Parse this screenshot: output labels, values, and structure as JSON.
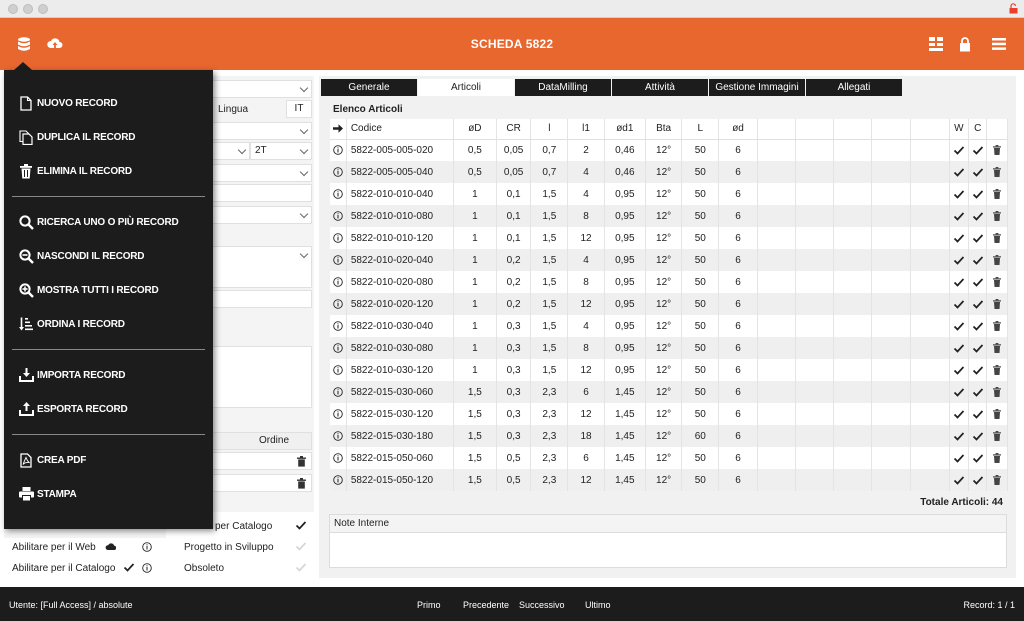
{
  "header": {
    "title": "SCHEDA 5822",
    "accent_color": "#e8672f"
  },
  "left_form": {
    "lingua_label": "Lingua",
    "lingua_value": "IT",
    "select_value": "2T",
    "ordine_header": "Ordine",
    "flags": [
      {
        "label": "Abilitare per il Web"
      },
      {
        "label": "Abilitare per il Catalogo"
      }
    ],
    "status_options": [
      {
        "label": "per Catalogo"
      },
      {
        "label": "Progetto in Sviluppo"
      },
      {
        "label": "Obsoleto"
      }
    ]
  },
  "tabs": [
    {
      "label": "Generale"
    },
    {
      "label": "Articoli"
    },
    {
      "label": "DataMilling"
    },
    {
      "label": "Attività"
    },
    {
      "label": "Gestione Immagini"
    },
    {
      "label": "Allegati"
    }
  ],
  "active_tab": 1,
  "articles": {
    "title": "Elenco Articoli",
    "columns": [
      "Codice",
      "øD",
      "CR",
      "l",
      "l1",
      "ød1",
      "Bta",
      "L",
      "ød"
    ],
    "flag_columns": [
      "W",
      "C"
    ],
    "rows": [
      [
        "5822-005-005-020",
        "0,5",
        "0,05",
        "0,7",
        "2",
        "0,46",
        "12°",
        "50",
        "6"
      ],
      [
        "5822-005-005-040",
        "0,5",
        "0,05",
        "0,7",
        "4",
        "0,46",
        "12°",
        "50",
        "6"
      ],
      [
        "5822-010-010-040",
        "1",
        "0,1",
        "1,5",
        "4",
        "0,95",
        "12°",
        "50",
        "6"
      ],
      [
        "5822-010-010-080",
        "1",
        "0,1",
        "1,5",
        "8",
        "0,95",
        "12°",
        "50",
        "6"
      ],
      [
        "5822-010-010-120",
        "1",
        "0,1",
        "1,5",
        "12",
        "0,95",
        "12°",
        "50",
        "6"
      ],
      [
        "5822-010-020-040",
        "1",
        "0,2",
        "1,5",
        "4",
        "0,95",
        "12°",
        "50",
        "6"
      ],
      [
        "5822-010-020-080",
        "1",
        "0,2",
        "1,5",
        "8",
        "0,95",
        "12°",
        "50",
        "6"
      ],
      [
        "5822-010-020-120",
        "1",
        "0,2",
        "1,5",
        "12",
        "0,95",
        "12°",
        "50",
        "6"
      ],
      [
        "5822-010-030-040",
        "1",
        "0,3",
        "1,5",
        "4",
        "0,95",
        "12°",
        "50",
        "6"
      ],
      [
        "5822-010-030-080",
        "1",
        "0,3",
        "1,5",
        "8",
        "0,95",
        "12°",
        "50",
        "6"
      ],
      [
        "5822-010-030-120",
        "1",
        "0,3",
        "1,5",
        "12",
        "0,95",
        "12°",
        "50",
        "6"
      ],
      [
        "5822-015-030-060",
        "1,5",
        "0,3",
        "2,3",
        "6",
        "1,45",
        "12°",
        "50",
        "6"
      ],
      [
        "5822-015-030-120",
        "1,5",
        "0,3",
        "2,3",
        "12",
        "1,45",
        "12°",
        "50",
        "6"
      ],
      [
        "5822-015-030-180",
        "1,5",
        "0,3",
        "2,3",
        "18",
        "1,45",
        "12°",
        "60",
        "6"
      ],
      [
        "5822-015-050-060",
        "1,5",
        "0,5",
        "2,3",
        "6",
        "1,45",
        "12°",
        "50",
        "6"
      ],
      [
        "5822-015-050-120",
        "1,5",
        "0,5",
        "2,3",
        "12",
        "1,45",
        "12°",
        "50",
        "6"
      ]
    ],
    "total": "Totale Articoli: 44"
  },
  "notes": {
    "label": "Note Interne"
  },
  "menu": {
    "items": [
      {
        "label": "NUOVO RECORD",
        "icon": "new-document-icon"
      },
      {
        "label": "DUPLICA IL RECORD",
        "icon": "duplicate-icon"
      },
      {
        "label": "ELIMINA IL RECORD",
        "icon": "trash-icon"
      },
      {
        "label": "RICERCA UNO O PIÙ RECORD",
        "icon": "search-icon"
      },
      {
        "label": "NASCONDI IL RECORD",
        "icon": "zoom-out-icon"
      },
      {
        "label": "MOSTRA TUTTI I RECORD",
        "icon": "zoom-in-icon"
      },
      {
        "label": "ORDINA I RECORD",
        "icon": "sort-icon"
      },
      {
        "label": "IMPORTA RECORD",
        "icon": "import-icon"
      },
      {
        "label": "ESPORTA RECORD",
        "icon": "export-icon"
      },
      {
        "label": "CREA PDF",
        "icon": "pdf-icon"
      },
      {
        "label": "STAMPA",
        "icon": "print-icon"
      }
    ]
  },
  "status": {
    "user": "Utente: [Full Access] / absolute",
    "first": "Primo",
    "prev": "Precedente",
    "next": "Successivo",
    "last": "Ultimo",
    "record": "Record: 1 / 1"
  }
}
